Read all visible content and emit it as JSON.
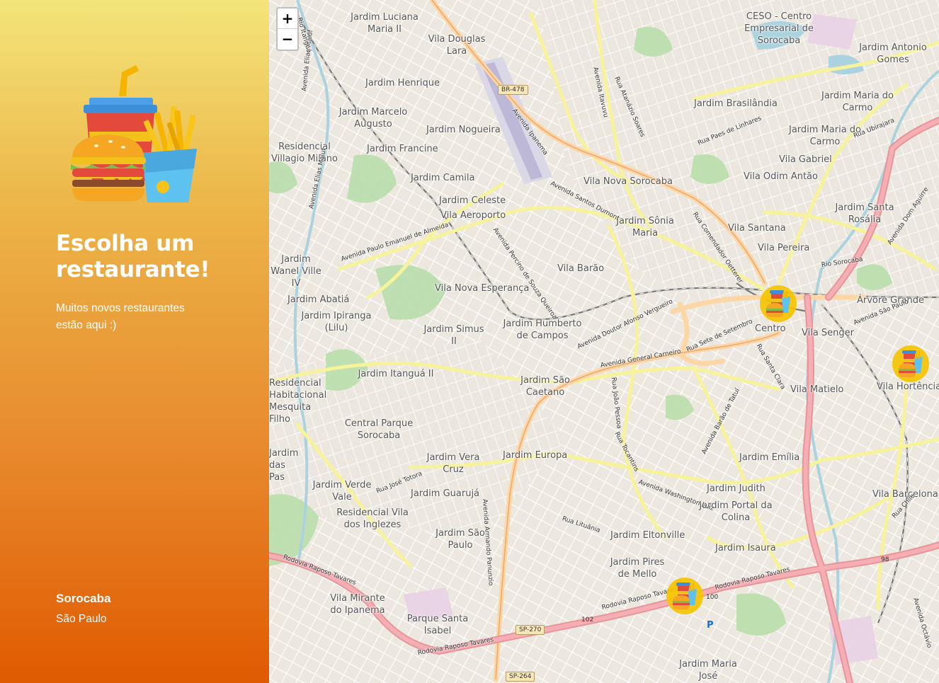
{
  "sidebar": {
    "logo_icon": "fast-food-icon",
    "title": "Escolha um restaurante!",
    "subtitle": "Muitos novos restaurantes estão aqui :)",
    "city": "Sorocaba",
    "state": "São Paulo"
  },
  "map": {
    "zoom_in_label": "+",
    "zoom_out_label": "−",
    "marker_icon": "restaurant-marker-icon",
    "neighborhoods": [
      "Jardim Luciana Maria II",
      "Vila Douglas Lara",
      "Jardim Henrique",
      "Jardim Marcelo Augusto",
      "Jardim Nogueira",
      "Residencial Villagio Milano",
      "Jardim Francine",
      "Jardim Camila",
      "Jardim Celeste",
      "Vila Aeroporto",
      "Jardim Wanel Ville IV",
      "Jardim Abatiá",
      "Jardim Ipiranga (Lilu)",
      "Vila Nova Esperança",
      "Jardim Simus II",
      "Jardim Humberto de Campos",
      "Jardim Itanguá II",
      "Residencial Habitacional Mesquita Filho",
      "Central Parque Sorocaba",
      "Jardim Vera Cruz",
      "Jardim Europa",
      "Jardim São Caetano",
      "Jardim Verde Vale",
      "Jardim Guarujá",
      "Residencial Vila dos Inglezes",
      "Jardim São Paulo",
      "Vila Mirante do Ipanema",
      "Parque Santa Isabel",
      "Jardim das Pas",
      "CESO - Centro Empresarial de Sorocaba",
      "Jardim Antonio Gomes",
      "Jardim Maria do Carmo",
      "Jardim Brasilândia",
      "Jardim Maria do Carmo",
      "Vila Gabriel",
      "Vila Odim Antão",
      "Vila Nova Sorocaba",
      "Jardim Santa Rosália",
      "Jardim Sônia Maria",
      "Vila Santana",
      "Vila Pereira",
      "Vila Barão",
      "Centro",
      "Árvore Grande",
      "Vila Senger",
      "Vila Hortência",
      "Vila Matielo",
      "Jardim Emília",
      "Jardim Judith",
      "Jardim Portal da Colina",
      "Jardim Eltonville",
      "Jardim Isaura",
      "Jardim Pires de Mello",
      "Vila Barcelona",
      "Jardim Maria José"
    ],
    "roads": [
      "BR-478",
      "Avenida Ipanema",
      "Avenida Itavuvu",
      "Rua Atanázio Soares",
      "Rua Paes de Linhares",
      "Rua Ubirajara",
      "Avenida Santos Dumont",
      "Rua Comendador Oetterer",
      "Avenida Paulo Emanuel de Almeida",
      "Avenida Percino de Souza Queiroz",
      "Avenida Doutor Afonso Vergueiro",
      "Rua Sete de Setembro",
      "Avenida General Carneiro",
      "Rua Santa Clara",
      "Avenida São Paulo",
      "Avenida Dom Aguirre",
      "Rio Sorocaba",
      "Rua João Pessoa",
      "Rua Tocantins",
      "Avenida Washington Luiz",
      "Avenida Barão de Tatuí",
      "Rua José Totora",
      "Avenida Armando Panunzio",
      "Rua Lituânia",
      "Rodovia Raposo Tavares",
      "Rua Chile",
      "Avenida Elias Maluf",
      "Rio Itanguá",
      "Avenida Octávio"
    ],
    "shields": [
      "BR-478",
      "SP-270",
      "SP-264",
      "100",
      "102",
      "98"
    ],
    "parking_label": "P"
  }
}
